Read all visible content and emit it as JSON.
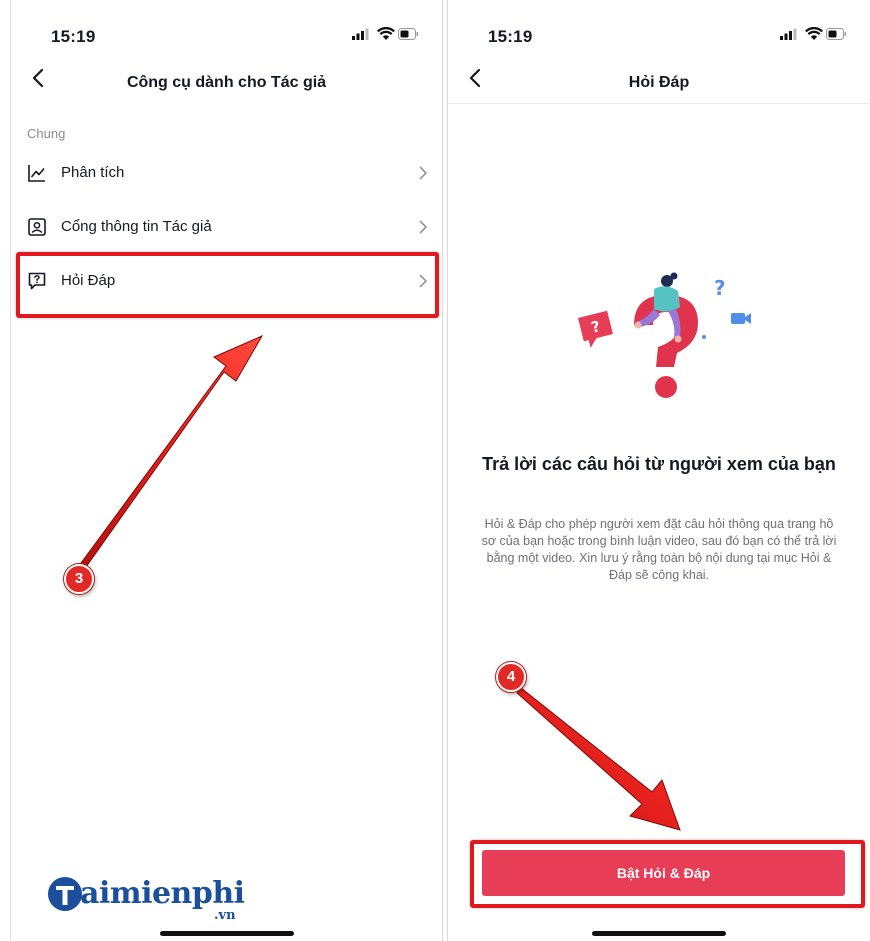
{
  "left_screen": {
    "status": {
      "time": "15:19"
    },
    "nav": {
      "title": "Công cụ dành cho Tác giả"
    },
    "section_label": "Chung",
    "menu_items": [
      {
        "label": "Phân tích",
        "icon": "analytics-icon"
      },
      {
        "label": "Cổng thông tin Tác giả",
        "icon": "creator-portal-icon"
      },
      {
        "label": "Hỏi Đáp",
        "icon": "qa-icon"
      }
    ],
    "step_badge": "3"
  },
  "right_screen": {
    "status": {
      "time": "15:19"
    },
    "nav": {
      "title": "Hỏi Đáp"
    },
    "headline": "Trả lời các câu hỏi từ người xem của bạn",
    "description": "Hỏi & Đáp cho phép người xem đặt câu hỏi thông qua trang hồ sơ của bạn hoặc trong bình luận video, sau đó bạn có thể trả lời bằng một video. Xin lưu ý rằng toàn bộ nội dung tại mục Hỏi & Đáp sẽ công khai.",
    "cta_label": "Bật Hỏi & Đáp",
    "step_badge": "4"
  },
  "watermark": {
    "brand": "aimienphi",
    "suffix": ".vn"
  },
  "colors": {
    "accent": "#E83D56",
    "annotation_red": "#E0191F",
    "logo_blue": "#1B4F9C"
  }
}
